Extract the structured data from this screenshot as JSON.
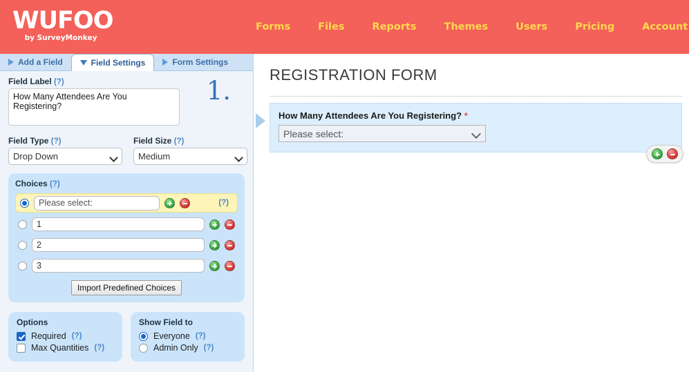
{
  "header": {
    "logo_text": "WUFOO",
    "logo_sub": "by SurveyMonkey",
    "nav": [
      {
        "label": "Forms",
        "icon": ""
      },
      {
        "label": "Files",
        "icon": ""
      },
      {
        "label": "Reports",
        "icon": ""
      },
      {
        "label": "Themes",
        "icon": ""
      },
      {
        "label": "Users",
        "icon": ""
      },
      {
        "label": "Pricing",
        "icon": ""
      },
      {
        "label": "Account",
        "icon": "chevron-down-icon"
      }
    ],
    "brand_color": "#f4605a",
    "nav_color": "#ffd84d"
  },
  "tabs": [
    {
      "label": "Add a Field",
      "active": false,
      "icon": "triangle-right-icon"
    },
    {
      "label": "Field Settings",
      "active": true,
      "icon": "triangle-down-icon"
    },
    {
      "label": "Form Settings",
      "active": false,
      "icon": "triangle-right-icon"
    }
  ],
  "settings": {
    "field_label": {
      "label": "Field Label",
      "help": "(?)",
      "value": "How Many Attendees Are You Registering?"
    },
    "field_number": "1.",
    "field_type": {
      "label": "Field Type",
      "help": "(?)",
      "value": "Drop Down",
      "options": [
        "Drop Down"
      ]
    },
    "field_size": {
      "label": "Field Size",
      "help": "(?)",
      "value": "Medium",
      "options": [
        "Medium"
      ]
    },
    "choices": {
      "label": "Choices",
      "help": "(?)",
      "row_help": "(?)",
      "items": [
        {
          "value": "",
          "placeholder": "Please select:",
          "selected": true,
          "highlight": true
        },
        {
          "value": "1",
          "placeholder": "",
          "selected": false,
          "highlight": false
        },
        {
          "value": "2",
          "placeholder": "",
          "selected": false,
          "highlight": false
        },
        {
          "value": "3",
          "placeholder": "",
          "selected": false,
          "highlight": false
        }
      ],
      "import_button": "Import Predefined Choices",
      "add_icon": "plus-circle-icon",
      "remove_icon": "minus-circle-icon"
    },
    "options": {
      "title": "Options",
      "items": [
        {
          "label": "Required",
          "help": "(?)",
          "checked": true
        },
        {
          "label": "Max Quantities",
          "help": "(?)",
          "checked": false
        }
      ]
    },
    "show_field_to": {
      "title": "Show Field to",
      "items": [
        {
          "label": "Everyone",
          "help": "(?)",
          "selected": true
        },
        {
          "label": "Admin Only",
          "help": "(?)",
          "selected": false
        }
      ]
    }
  },
  "preview": {
    "form_title": "REGISTRATION FORM",
    "field": {
      "question": "How Many Attendees Are You Registering?",
      "required_marker": "*",
      "select_value": "Please select:",
      "select_options": [
        "Please select:"
      ]
    },
    "actions": {
      "add_icon": "plus-circle-icon",
      "remove_icon": "minus-circle-icon"
    }
  }
}
